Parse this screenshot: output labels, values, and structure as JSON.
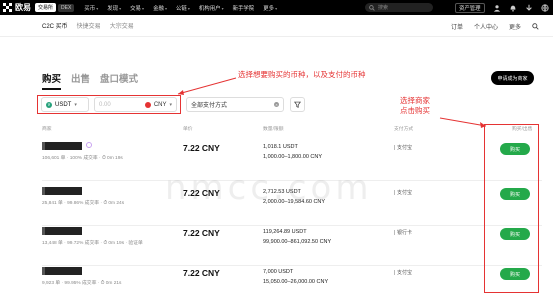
{
  "nav": {
    "logo_text": "欧易",
    "pill_exchange": "交易所",
    "pill_dex": "DEX",
    "items": [
      "买币",
      "发现",
      "交易",
      "金融",
      "公链",
      "机构用户",
      "新手学院",
      "更多"
    ],
    "search_placeholder": "搜索",
    "account_label": "资产管理",
    "user_icon": "user-icon"
  },
  "subnav": {
    "tabs": [
      "C2C 买币",
      "快捷交易",
      "大宗交易"
    ],
    "active_tab": "C2C 买币",
    "right_items": [
      "订单",
      "个人中心",
      "更多"
    ]
  },
  "trade": {
    "tabs": [
      "购买",
      "出售",
      "盘口模式"
    ],
    "active_tab": "购买",
    "apply_label": "申请成为商家"
  },
  "filters": {
    "coin": "USDT",
    "amount_placeholder": "0.00",
    "currency": "CNY",
    "payment": "全部支付方式"
  },
  "annotations": {
    "select_currency": "选择想要购买的币种，以及支付的币种",
    "select_merchant_line1": "选择商家",
    "select_merchant_line2": "点击购买"
  },
  "table": {
    "headers": {
      "merchant": "商家",
      "price": "单价",
      "qty": "数量/限额",
      "payment": "支付方式",
      "action": "购买/出售"
    },
    "rows": [
      {
        "stats": "106,601 单 · 100% 成交率 · ⏱ 0m 19s",
        "price": "7.22 CNY",
        "amount": "1,018.1 USDT",
        "limit": "1,000.00–1,800.00 CNY",
        "payment": "支付宝",
        "buy": "购买",
        "badge": true
      },
      {
        "stats": "25,841 单 · 99.86% 成交率 · ⏱ 0m 24s",
        "price": "7.22 CNY",
        "amount": "2,712.53 USDT",
        "limit": "2,000.00–19,584.60 CNY",
        "payment": "支付宝",
        "buy": "购买",
        "badge": false
      },
      {
        "stats": "13,448 单 · 99.72% 成交率 · ⏱ 0m 19s · 验证单",
        "price": "7.22 CNY",
        "amount": "119,264.89 USDT",
        "limit": "99,900.00–861,092.50 CNY",
        "payment": "银行卡",
        "buy": "购买",
        "badge": false
      },
      {
        "stats": "9,923 单 · 99.95% 成交率 · ⏱ 0m 21s",
        "price": "7.22 CNY",
        "amount": "7,000 USDT",
        "limit": "15,050.00–26,000.00 CNY",
        "payment": "支付宝",
        "buy": "购买",
        "badge": false
      }
    ]
  },
  "watermark": "nmcc.com",
  "colors": {
    "accent_green": "#24a94a",
    "annotation_red": "#e53333",
    "nav_bg": "#000000"
  }
}
